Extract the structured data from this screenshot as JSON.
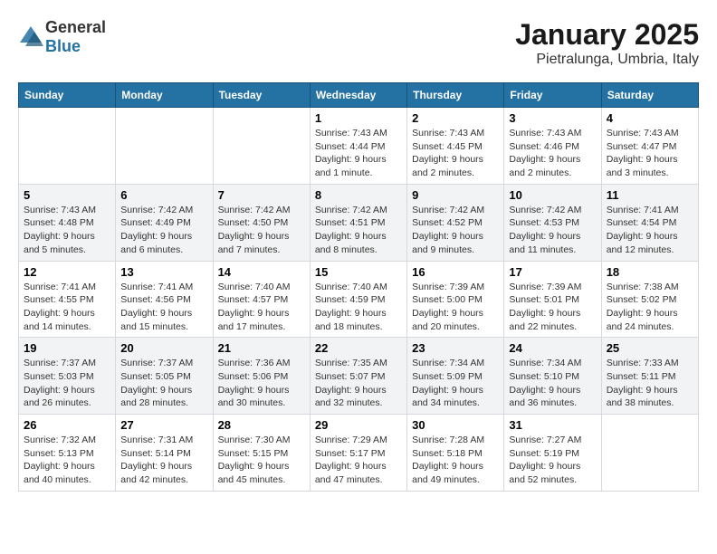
{
  "header": {
    "logo": {
      "text_general": "General",
      "text_blue": "Blue"
    },
    "month": "January 2025",
    "location": "Pietralunga, Umbria, Italy"
  },
  "weekdays": [
    "Sunday",
    "Monday",
    "Tuesday",
    "Wednesday",
    "Thursday",
    "Friday",
    "Saturday"
  ],
  "weeks": [
    [
      {
        "day": "",
        "info": ""
      },
      {
        "day": "",
        "info": ""
      },
      {
        "day": "",
        "info": ""
      },
      {
        "day": "1",
        "info": "Sunrise: 7:43 AM\nSunset: 4:44 PM\nDaylight: 9 hours\nand 1 minute."
      },
      {
        "day": "2",
        "info": "Sunrise: 7:43 AM\nSunset: 4:45 PM\nDaylight: 9 hours\nand 2 minutes."
      },
      {
        "day": "3",
        "info": "Sunrise: 7:43 AM\nSunset: 4:46 PM\nDaylight: 9 hours\nand 2 minutes."
      },
      {
        "day": "4",
        "info": "Sunrise: 7:43 AM\nSunset: 4:47 PM\nDaylight: 9 hours\nand 3 minutes."
      }
    ],
    [
      {
        "day": "5",
        "info": "Sunrise: 7:43 AM\nSunset: 4:48 PM\nDaylight: 9 hours\nand 5 minutes."
      },
      {
        "day": "6",
        "info": "Sunrise: 7:42 AM\nSunset: 4:49 PM\nDaylight: 9 hours\nand 6 minutes."
      },
      {
        "day": "7",
        "info": "Sunrise: 7:42 AM\nSunset: 4:50 PM\nDaylight: 9 hours\nand 7 minutes."
      },
      {
        "day": "8",
        "info": "Sunrise: 7:42 AM\nSunset: 4:51 PM\nDaylight: 9 hours\nand 8 minutes."
      },
      {
        "day": "9",
        "info": "Sunrise: 7:42 AM\nSunset: 4:52 PM\nDaylight: 9 hours\nand 9 minutes."
      },
      {
        "day": "10",
        "info": "Sunrise: 7:42 AM\nSunset: 4:53 PM\nDaylight: 9 hours\nand 11 minutes."
      },
      {
        "day": "11",
        "info": "Sunrise: 7:41 AM\nSunset: 4:54 PM\nDaylight: 9 hours\nand 12 minutes."
      }
    ],
    [
      {
        "day": "12",
        "info": "Sunrise: 7:41 AM\nSunset: 4:55 PM\nDaylight: 9 hours\nand 14 minutes."
      },
      {
        "day": "13",
        "info": "Sunrise: 7:41 AM\nSunset: 4:56 PM\nDaylight: 9 hours\nand 15 minutes."
      },
      {
        "day": "14",
        "info": "Sunrise: 7:40 AM\nSunset: 4:57 PM\nDaylight: 9 hours\nand 17 minutes."
      },
      {
        "day": "15",
        "info": "Sunrise: 7:40 AM\nSunset: 4:59 PM\nDaylight: 9 hours\nand 18 minutes."
      },
      {
        "day": "16",
        "info": "Sunrise: 7:39 AM\nSunset: 5:00 PM\nDaylight: 9 hours\nand 20 minutes."
      },
      {
        "day": "17",
        "info": "Sunrise: 7:39 AM\nSunset: 5:01 PM\nDaylight: 9 hours\nand 22 minutes."
      },
      {
        "day": "18",
        "info": "Sunrise: 7:38 AM\nSunset: 5:02 PM\nDaylight: 9 hours\nand 24 minutes."
      }
    ],
    [
      {
        "day": "19",
        "info": "Sunrise: 7:37 AM\nSunset: 5:03 PM\nDaylight: 9 hours\nand 26 minutes."
      },
      {
        "day": "20",
        "info": "Sunrise: 7:37 AM\nSunset: 5:05 PM\nDaylight: 9 hours\nand 28 minutes."
      },
      {
        "day": "21",
        "info": "Sunrise: 7:36 AM\nSunset: 5:06 PM\nDaylight: 9 hours\nand 30 minutes."
      },
      {
        "day": "22",
        "info": "Sunrise: 7:35 AM\nSunset: 5:07 PM\nDaylight: 9 hours\nand 32 minutes."
      },
      {
        "day": "23",
        "info": "Sunrise: 7:34 AM\nSunset: 5:09 PM\nDaylight: 9 hours\nand 34 minutes."
      },
      {
        "day": "24",
        "info": "Sunrise: 7:34 AM\nSunset: 5:10 PM\nDaylight: 9 hours\nand 36 minutes."
      },
      {
        "day": "25",
        "info": "Sunrise: 7:33 AM\nSunset: 5:11 PM\nDaylight: 9 hours\nand 38 minutes."
      }
    ],
    [
      {
        "day": "26",
        "info": "Sunrise: 7:32 AM\nSunset: 5:13 PM\nDaylight: 9 hours\nand 40 minutes."
      },
      {
        "day": "27",
        "info": "Sunrise: 7:31 AM\nSunset: 5:14 PM\nDaylight: 9 hours\nand 42 minutes."
      },
      {
        "day": "28",
        "info": "Sunrise: 7:30 AM\nSunset: 5:15 PM\nDaylight: 9 hours\nand 45 minutes."
      },
      {
        "day": "29",
        "info": "Sunrise: 7:29 AM\nSunset: 5:17 PM\nDaylight: 9 hours\nand 47 minutes."
      },
      {
        "day": "30",
        "info": "Sunrise: 7:28 AM\nSunset: 5:18 PM\nDaylight: 9 hours\nand 49 minutes."
      },
      {
        "day": "31",
        "info": "Sunrise: 7:27 AM\nSunset: 5:19 PM\nDaylight: 9 hours\nand 52 minutes."
      },
      {
        "day": "",
        "info": ""
      }
    ]
  ]
}
